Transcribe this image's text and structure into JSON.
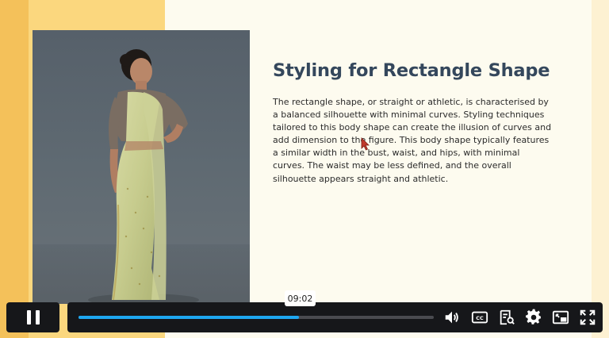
{
  "slide": {
    "title": "Styling for Rectangle Shape",
    "body": "The rectangle shape, or straight or athletic, is characterised by a balanced silhouette with minimal curves. Styling techniques tailored to this body shape can create the illusion of curves and add dimension to the figure. This body shape typically features a similar width in the bust, waist, and hips, with minimal curves. The waist may be less defined, and the overall silhouette appears straight and athletic.",
    "image": "woman-in-saree-photo"
  },
  "player": {
    "state": "playing",
    "progress": 0.62,
    "hover_time": "09:02",
    "icons": [
      "pause-icon",
      "volume-icon",
      "closed-captions-icon",
      "transcript-icon",
      "settings-gear-icon",
      "picture-in-picture-icon",
      "fullscreen-icon"
    ],
    "colors": {
      "accent": "#1ea7f0",
      "bar": "#16171a",
      "track": "#4a4b50"
    }
  },
  "colors": {
    "title": "#34475c",
    "band_dark": "#f4c15a",
    "band_light": "#fbd77e",
    "card": "#fdfbef"
  }
}
